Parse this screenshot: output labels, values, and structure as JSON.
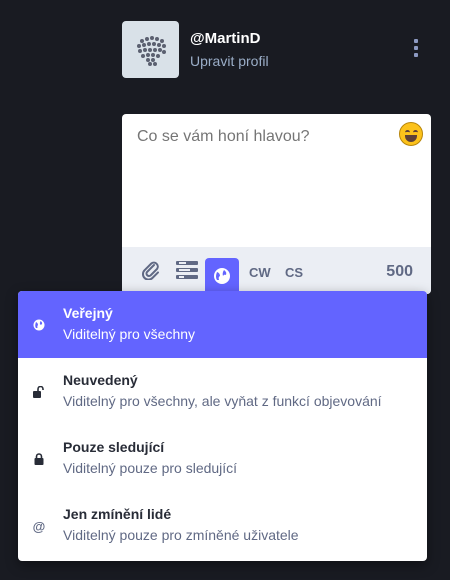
{
  "profile": {
    "username": "@MartinD",
    "edit_label": "Upravit profil"
  },
  "composer": {
    "placeholder": "Co se vám honí hlavou?",
    "cw_label": "CW",
    "lang_label": "CS",
    "char_count": "500"
  },
  "privacy": {
    "options": [
      {
        "title": "Veřejný",
        "desc": "Viditelný pro všechny",
        "icon": "globe-icon",
        "selected": true
      },
      {
        "title": "Neuvedený",
        "desc": "Viditelný pro všechny, ale vyňat z funkcí objevování",
        "icon": "unlock-icon",
        "selected": false
      },
      {
        "title": "Pouze sledující",
        "desc": "Viditelný pouze pro sledující",
        "icon": "lock-icon",
        "selected": false
      },
      {
        "title": "Jen zmínění lidé",
        "desc": "Viditelný pouze pro zmíněné uživatele",
        "icon": "at-icon",
        "selected": false
      }
    ]
  },
  "colors": {
    "accent": "#6364ff",
    "background": "#191b22",
    "toolbar": "#ebeef4"
  }
}
